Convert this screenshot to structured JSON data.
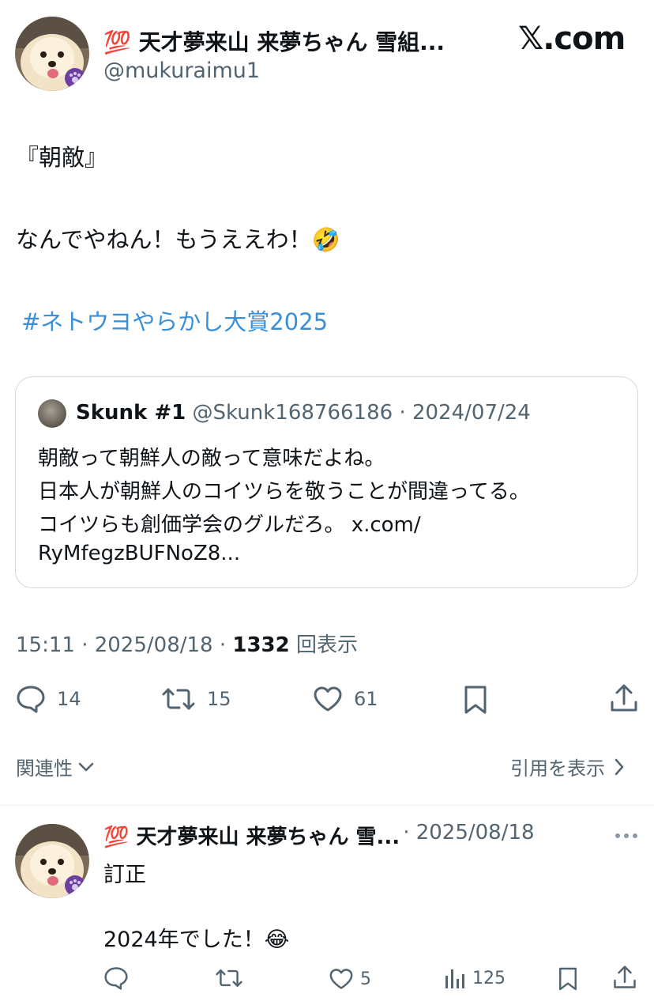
{
  "author": {
    "badge_emoji": "💯",
    "display_name": "天才夢来山 来夢ちゃん 雪組...",
    "handle": "@mukuraimu1"
  },
  "source_site": "𝕏.com",
  "post": {
    "line1": "『朝敵』",
    "line2": "なんでやねん！もうええわ！🤣",
    "hashtag": "#ネトウヨやらかし大賞2025"
  },
  "quote": {
    "name": "Skunk #1",
    "handle_date": "@Skunk168766186 · 2024/07/24",
    "lines": [
      "朝敵って朝鮮人の敵って意味だよね。",
      "日本人が朝鮮人のコイツらを敬うことが間違ってる。",
      "コイツらも創価学会のグルだろ。 x.com/",
      "RyMfegzBUFNoZ8..."
    ]
  },
  "meta": {
    "time_date": "15:11 · 2025/08/18 · ",
    "views_count": "1332",
    "views_label": " 回表示"
  },
  "actions": {
    "replies": "14",
    "reposts": "15",
    "likes": "61"
  },
  "filter_bar": {
    "relevance_label": "関連性",
    "show_quotes_label": "引用を表示"
  },
  "reply": {
    "badge_emoji": "💯",
    "display_name": "天才夢来山 来夢ちゃん 雪...",
    "date": "· 2025/08/18",
    "line1": "訂正",
    "line2": "2024年でした！😂",
    "likes": "5",
    "views": "125"
  }
}
